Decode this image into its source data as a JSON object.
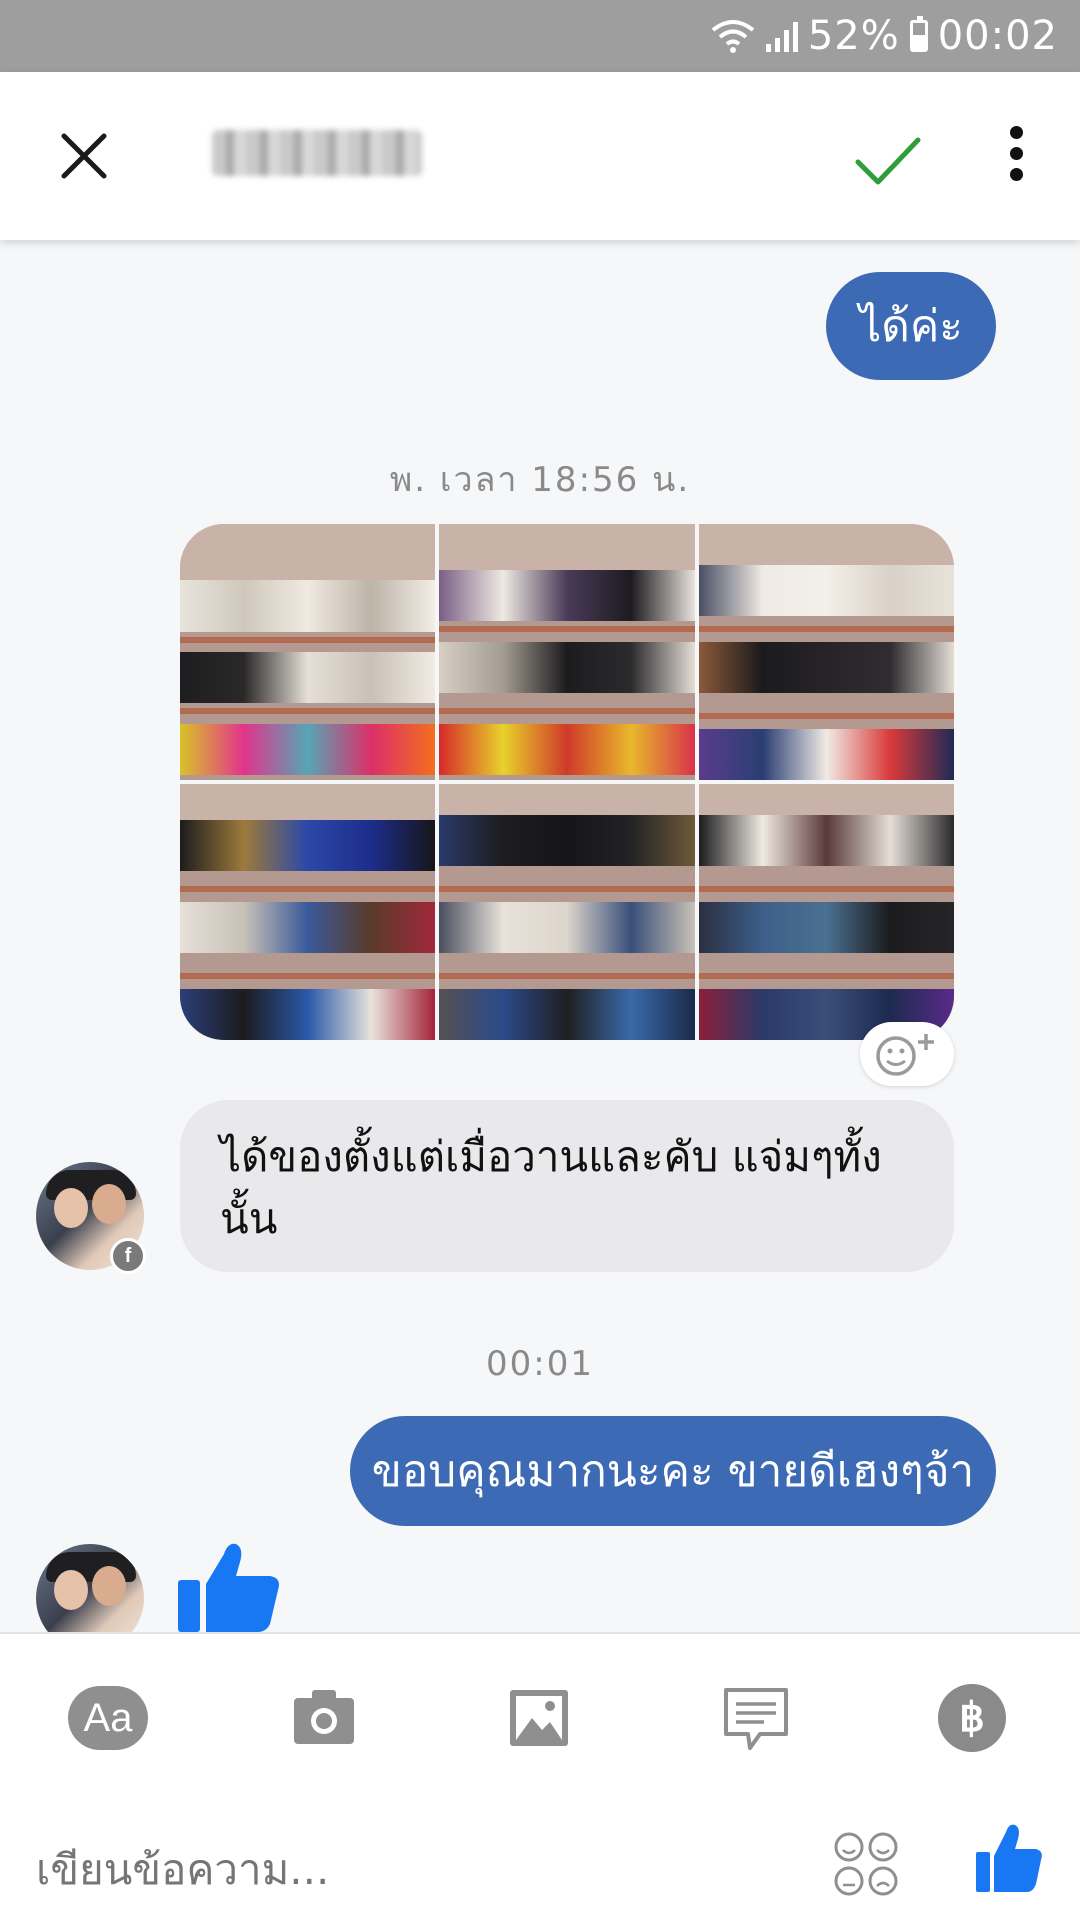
{
  "status": {
    "battery": "52%",
    "time": "00:02"
  },
  "header": {
    "title": ""
  },
  "messages": {
    "out1": "ได้ค่ะ",
    "ts1": "พ. เวลา 18:56 น.",
    "in1": "ได้ของตั้งแต่เมื่อวานและคับ แจ่มๆทั้งนั้น",
    "ts2": "00:01",
    "out2": "ขอบคุณมากนะคะ  ขายดีเฮงๆจ้า"
  },
  "composer": {
    "aa_label": "Aa",
    "baht_label": "฿",
    "placeholder": "เขียนข้อความ..."
  },
  "colors": {
    "accent": "#3d6ab4",
    "like": "#1877f2",
    "check": "#2e9e3a"
  }
}
